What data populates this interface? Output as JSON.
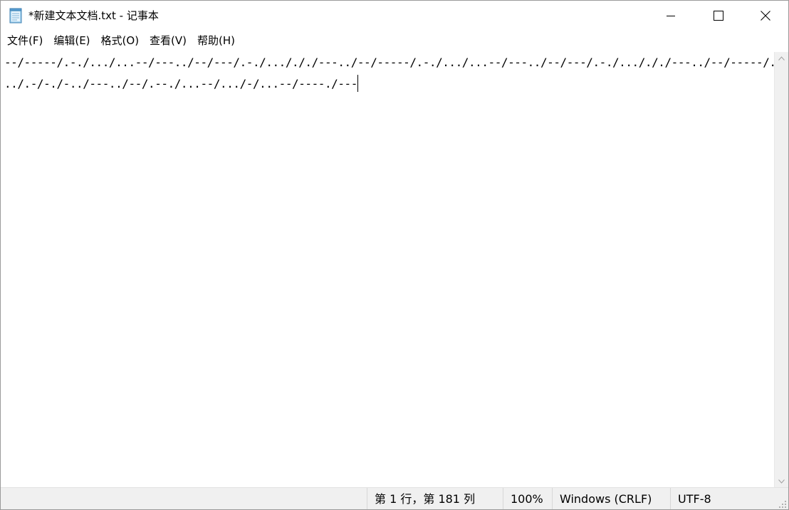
{
  "window": {
    "title": "*新建文本文档.txt - 记事本",
    "icon": "notepad-icon",
    "controls": {
      "minimize": "minimize-icon",
      "maximize": "maximize-icon",
      "close": "close-icon"
    }
  },
  "menu": {
    "items": [
      "文件(F)",
      "编辑(E)",
      "格式(O)",
      "查看(V)",
      "帮助(H)"
    ]
  },
  "editor": {
    "lines": [
      "--/-----/.-./.../...--/---../--/---/.-./.../././---../--/-----/.-./.../...--/---../--/---/.-./.../././---../--/-----/.-./.../././---",
      "../.-/-./-../---../--/.--./...--/.../-/...--/----./---"
    ]
  },
  "scrollbar": {
    "up_icon": "chevron-up-icon",
    "down_icon": "chevron-down-icon"
  },
  "status": {
    "position": "第 1 行，第 181 列",
    "zoom": "100%",
    "line_ending": "Windows (CRLF)",
    "encoding": "UTF-8"
  }
}
